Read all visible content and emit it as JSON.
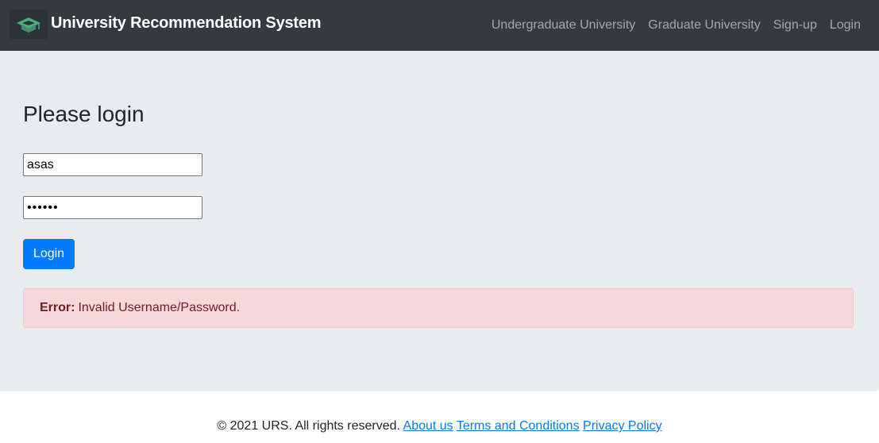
{
  "navbar": {
    "brand": "University Recommendation System",
    "logo_icon": "graduation-cap-icon",
    "links": [
      {
        "label": "Undergraduate University"
      },
      {
        "label": "Graduate University"
      },
      {
        "label": "Sign-up"
      },
      {
        "label": "Login"
      }
    ]
  },
  "login_form": {
    "title": "Please login",
    "username_value": "asas",
    "password_value": "aaaaaa",
    "submit_label": "Login"
  },
  "alert": {
    "prefix": "Error:",
    "message": "Invalid Username/Password."
  },
  "footer": {
    "copyright": "© 2021 URS. All rights reserved.",
    "links": [
      {
        "label": "About us"
      },
      {
        "label": "Terms and Conditions"
      },
      {
        "label": "Privacy Policy"
      }
    ]
  },
  "colors": {
    "navbar_bg": "#343a40",
    "jumbotron_bg": "#e9ecef",
    "primary": "#007bff",
    "alert_bg": "#f8d7da",
    "alert_text": "#721c24",
    "logo_accent": "#4caf7d"
  }
}
